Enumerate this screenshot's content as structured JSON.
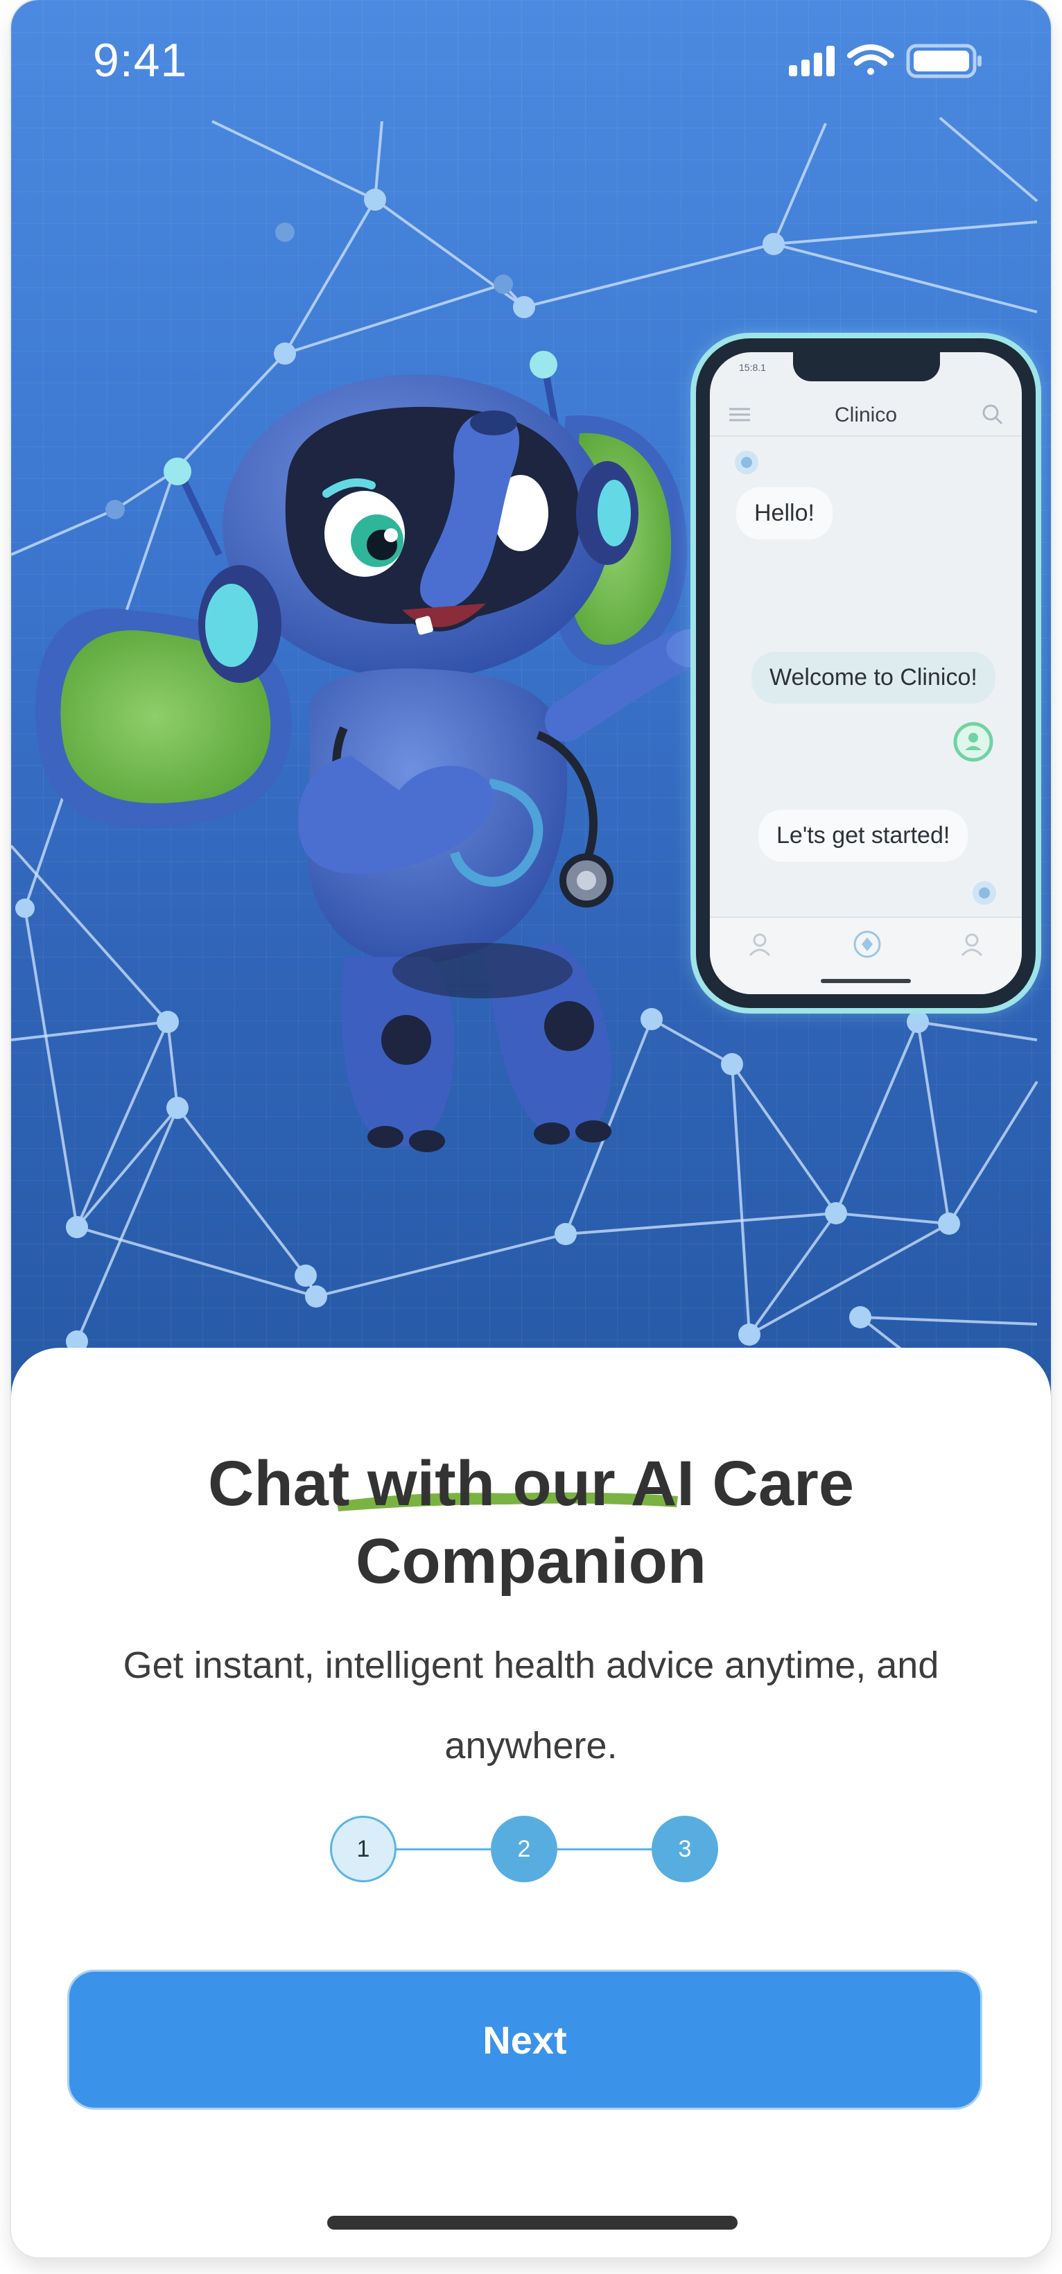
{
  "status_bar": {
    "time": "9:41",
    "signal_icon": "cellular-signal-icon",
    "wifi_icon": "wifi-icon",
    "battery_icon": "battery-icon"
  },
  "illustration": {
    "mascot": "robot-elephant-doctor",
    "phone": {
      "status_time": "15:8.1",
      "app_title": "Clinico",
      "messages": [
        {
          "text": "Hello!"
        },
        {
          "text": "Welcome to Clinico!"
        },
        {
          "text": "Le'ts get started!"
        }
      ]
    }
  },
  "onboarding": {
    "title_line1": "Chat with our AI Care",
    "title_line2": "Companion",
    "subtitle": "Get instant, intelligent health advice anytime, and anywhere.",
    "steps": [
      "1",
      "2",
      "3"
    ],
    "current_step": 1,
    "next_label": "Next"
  },
  "colors": {
    "hero_top": "#4b8ae0",
    "hero_bottom": "#265aa6",
    "accent_green": "#7bb342",
    "button_blue": "#3a93e8",
    "step_blue": "#58ade0"
  }
}
